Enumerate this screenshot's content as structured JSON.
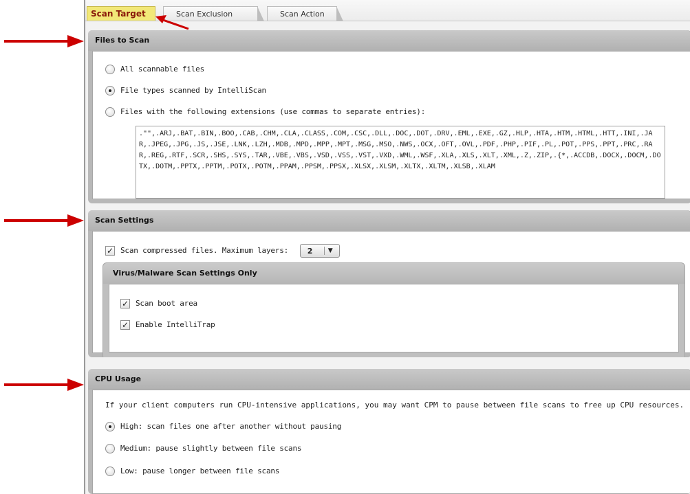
{
  "tabs": [
    {
      "label": "Scan Target",
      "active": true
    },
    {
      "label": "Scan Exclusion",
      "active": false
    },
    {
      "label": "Scan Action",
      "active": false
    }
  ],
  "files_to_scan": {
    "title": "Files to Scan",
    "options": [
      {
        "label": "All scannable files",
        "checked": false
      },
      {
        "label": "File types scanned by IntelliScan",
        "checked": true
      },
      {
        "label": "Files with the following extensions (use commas to separate entries):",
        "checked": false
      }
    ],
    "extensions": ".\"\",.ARJ,.BAT,.BIN,.BOO,.CAB,.CHM,.CLA,.CLASS,.COM,.CSC,.DLL,.DOC,.DOT,.DRV,.EML,.EXE,.GZ,.HLP,.HTA,.HTM,.HTML,.HTT,.INI,.JAR,.JPEG,.JPG,.JS,.JSE,.LNK,.LZH,.MDB,.MPD,.MPP,.MPT,.MSG,.MSO,.NWS,.OCX,.OFT,.OVL,.PDF,.PHP,.PIF,.PL,.POT,.PPS,.PPT,.PRC,.RAR,.REG,.RTF,.SCR,.SHS,.SYS,.TAR,.VBE,.VBS,.VSD,.VSS,.VST,.VXD,.WML,.WSF,.XLA,.XLS,.XLT,.XML,.Z,.ZIP,.{*,.ACCDB,.DOCX,.DOCM,.DOTX,.DOTM,.PPTX,.PPTM,.POTX,.POTM,.PPAM,.PPSM,.PPSX,.XLSX,.XLSM,.XLTX,.XLTM,.XLSB,.XLAM"
  },
  "scan_settings": {
    "title": "Scan Settings",
    "compressed_label": "Scan compressed files. Maximum layers:",
    "compressed_checked": true,
    "max_layers": "2",
    "virus_title": "Virus/Malware Scan Settings Only",
    "boot_area_label": "Scan boot area",
    "boot_area_checked": true,
    "intellitrap_label": "Enable IntelliTrap",
    "intellitrap_checked": true
  },
  "cpu_usage": {
    "title": "CPU Usage",
    "description": "If your client computers run CPU-intensive applications, you may want CPM to pause between file scans to free up CPU resources.",
    "options": [
      {
        "label": "High: scan files one after another without pausing",
        "checked": true
      },
      {
        "label": "Medium: pause slightly between file scans",
        "checked": false
      },
      {
        "label": "Low: pause longer between file scans",
        "checked": false
      }
    ]
  },
  "colors": {
    "annotation_arrow": "#cc0000",
    "active_tab_bg": "#f2e878",
    "section_header": "#b8b8b8"
  }
}
